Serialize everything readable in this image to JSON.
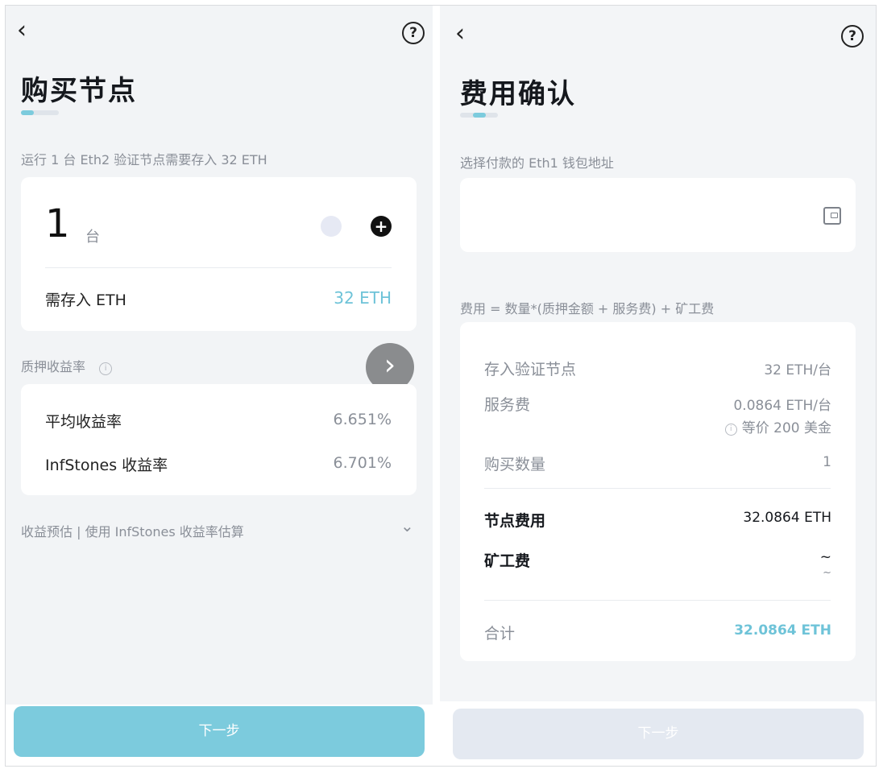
{
  "left": {
    "back_icon": "chevron-left-icon",
    "help_icon": "help-circle-icon",
    "help_glyph": "?",
    "back_glyph": "‹",
    "title": "购买节点",
    "progress": 0.33,
    "hint": "运行 1 台 Eth2 验证节点需要存入 32 ETH",
    "quantity": {
      "value": "1",
      "unit": "台",
      "minus_icon": "minus-circle-icon",
      "plus_icon": "plus-circle-icon",
      "plus_glyph": "+"
    },
    "deposit": {
      "label": "需存入 ETH",
      "value": "32 ETH"
    },
    "yield_section": {
      "label": "质押收益率",
      "info_icon": "info-icon",
      "info_glyph": "i"
    },
    "float_next_icon": "chevron-right-icon",
    "float_next_glyph": "›",
    "rates": [
      {
        "label": "平均收益率",
        "value": "6.651%"
      },
      {
        "label": "InfStones 收益率",
        "value": "6.701%"
      }
    ],
    "estimate": {
      "label": "收益预估 | 使用 InfStones 收益率估算",
      "chevron_icon": "chevron-down-icon",
      "chevron_glyph": "⌄"
    },
    "next_button": "下一步",
    "colors": {
      "accent": "#6ec3d8",
      "button": "#7ccbdd"
    }
  },
  "right": {
    "back_glyph": "‹",
    "help_glyph": "?",
    "title": "费用确认",
    "progress": 0.66,
    "wallet_label": "选择付款的 Eth1 钱包地址",
    "wallet_icon": "wallet-icon",
    "formula": "费用 = 数量*(质押金额 + 服务费) + 矿工费",
    "fees": {
      "deposit": {
        "label": "存入验证节点",
        "value": "32 ETH/台"
      },
      "service": {
        "label": "服务费",
        "value": "0.0864 ETH/台",
        "note": "等价 200 美金",
        "note_icon": "info-icon",
        "note_glyph": "i"
      },
      "quantity": {
        "label": "购买数量",
        "value": "1"
      },
      "node_fee": {
        "label": "节点费用",
        "value": "32.0864 ETH"
      },
      "gas_fee": {
        "label": "矿工费",
        "value": "~",
        "sub": "~"
      },
      "total": {
        "label": "合计",
        "value": "32.0864 ETH"
      }
    },
    "next_button": "下一步",
    "colors": {
      "button_disabled": "#e4e9f1"
    }
  }
}
